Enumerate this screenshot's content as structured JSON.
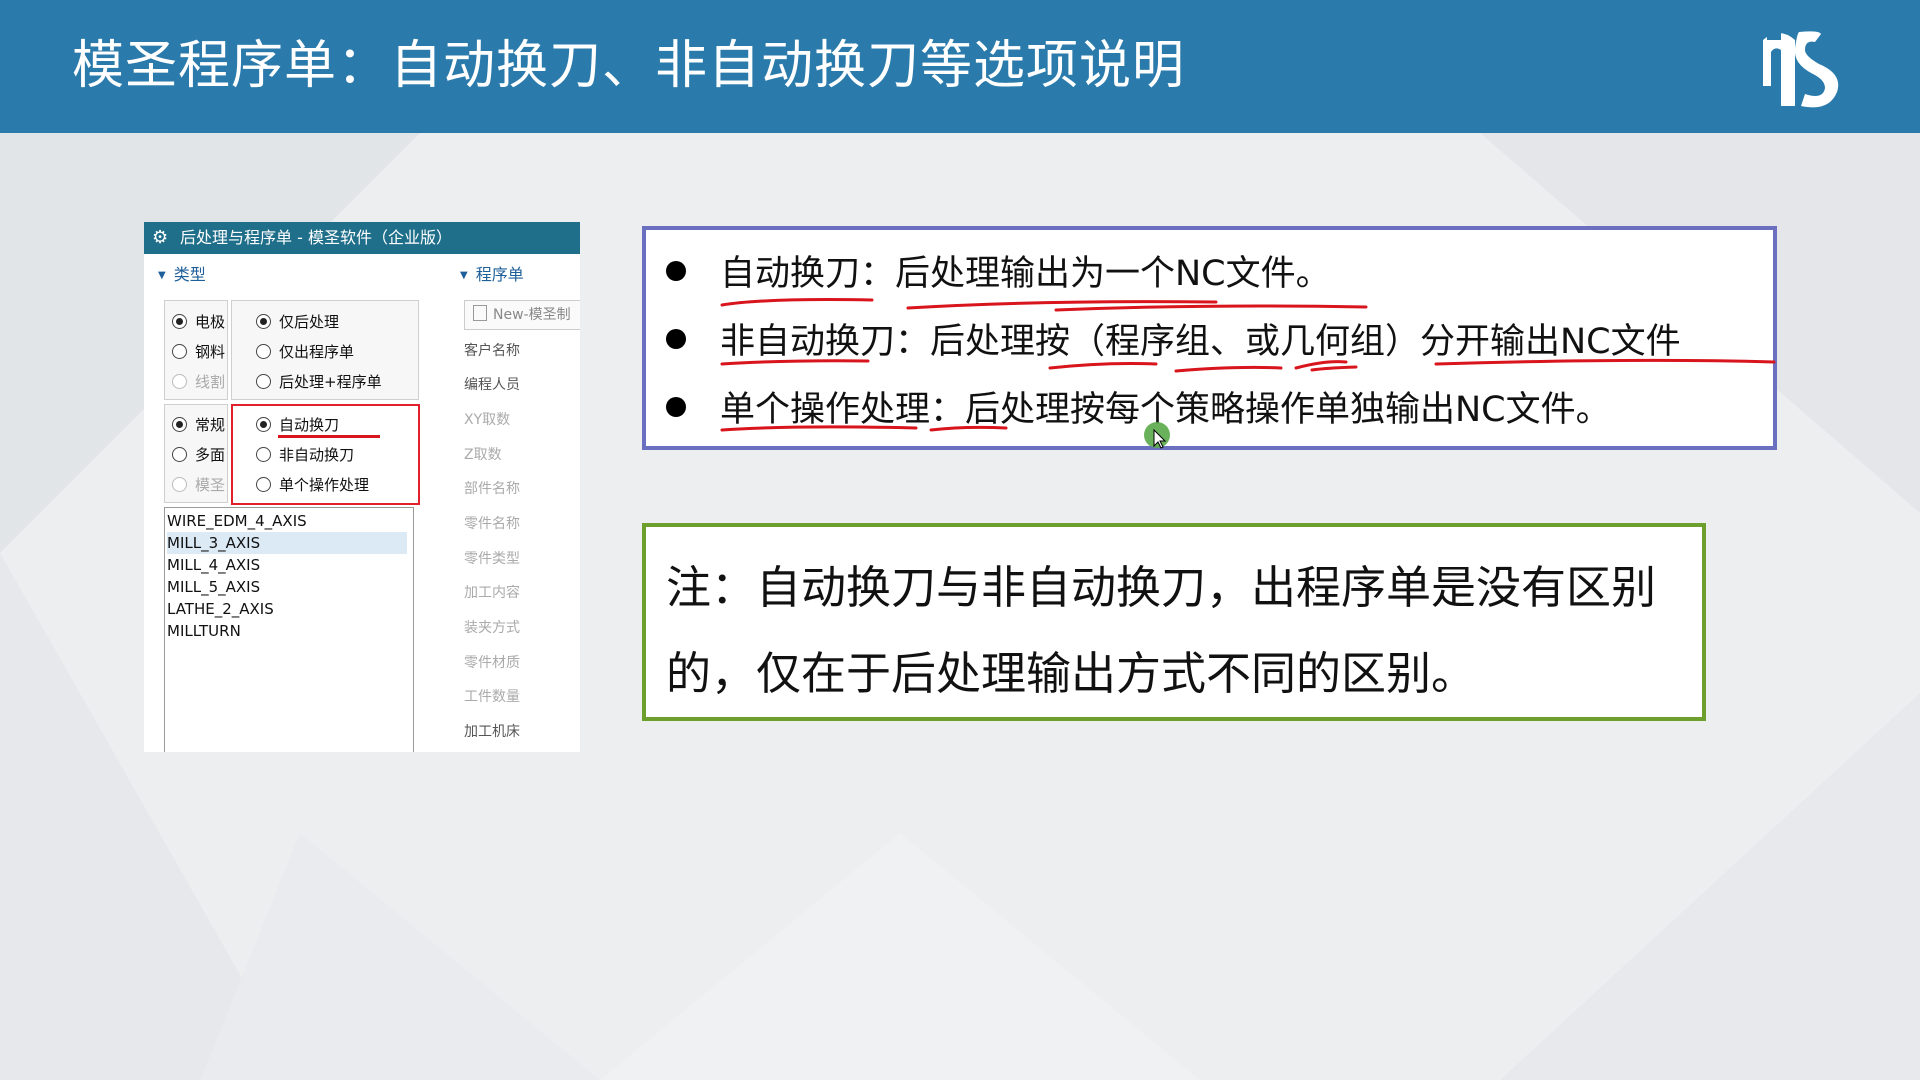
{
  "slide": {
    "title": "模圣程序单：自动换刀、非自动换刀等选项说明",
    "colors": {
      "header": "#2a7bab",
      "bullet_border": "#6a6fbf",
      "note_border": "#6d9f2c",
      "underline": "#d8141c"
    }
  },
  "panel": {
    "window_title": "后处理与程序单 - 模圣软件（企业版）",
    "section_type": "类型",
    "section_sheet": "程序单",
    "radios_left_top": [
      {
        "label": "电极",
        "selected": true,
        "disabled": false
      },
      {
        "label": "钢料",
        "selected": false,
        "disabled": false
      },
      {
        "label": "线割",
        "selected": false,
        "disabled": true
      }
    ],
    "radios_right_top": [
      {
        "label": "仅后处理",
        "selected": true
      },
      {
        "label": "仅出程序单",
        "selected": false
      },
      {
        "label": "后处理+程序单",
        "selected": false
      }
    ],
    "radios_left_bottom": [
      {
        "label": "常规",
        "selected": true,
        "disabled": false
      },
      {
        "label": "多面",
        "selected": false,
        "disabled": false
      },
      {
        "label": "模圣",
        "selected": false,
        "disabled": true
      }
    ],
    "radios_right_bottom": [
      {
        "label": "自动换刀",
        "selected": true
      },
      {
        "label": "非自动换刀",
        "selected": false
      },
      {
        "label": "单个操作处理",
        "selected": false
      }
    ],
    "machines": [
      "WIRE_EDM_4_AXIS",
      "MILL_3_AXIS",
      "MILL_4_AXIS",
      "MILL_5_AXIS",
      "LATHE_2_AXIS",
      "MILLTURN"
    ],
    "selected_machine": "MILL_3_AXIS",
    "new_sheet_value": "New-模圣制",
    "fields": [
      "客户名称",
      "编程人员",
      "XY取数",
      "Z取数",
      "部件名称",
      "零件名称",
      "零件类型",
      "加工内容",
      "装夹方式",
      "零件材质",
      "工件数量",
      "加工机床"
    ]
  },
  "bullets": [
    "自动换刀：后处理输出为一个NC文件。",
    "非自动换刀：后处理按（程序组、或几何组）分开输出NC文件",
    "单个操作处理：后处理按每个策略操作单独输出NC文件。"
  ],
  "note": {
    "text": "注：自动换刀与非自动换刀，出程序单是没有区别的，仅在于后处理输出方式不同的区别。"
  }
}
